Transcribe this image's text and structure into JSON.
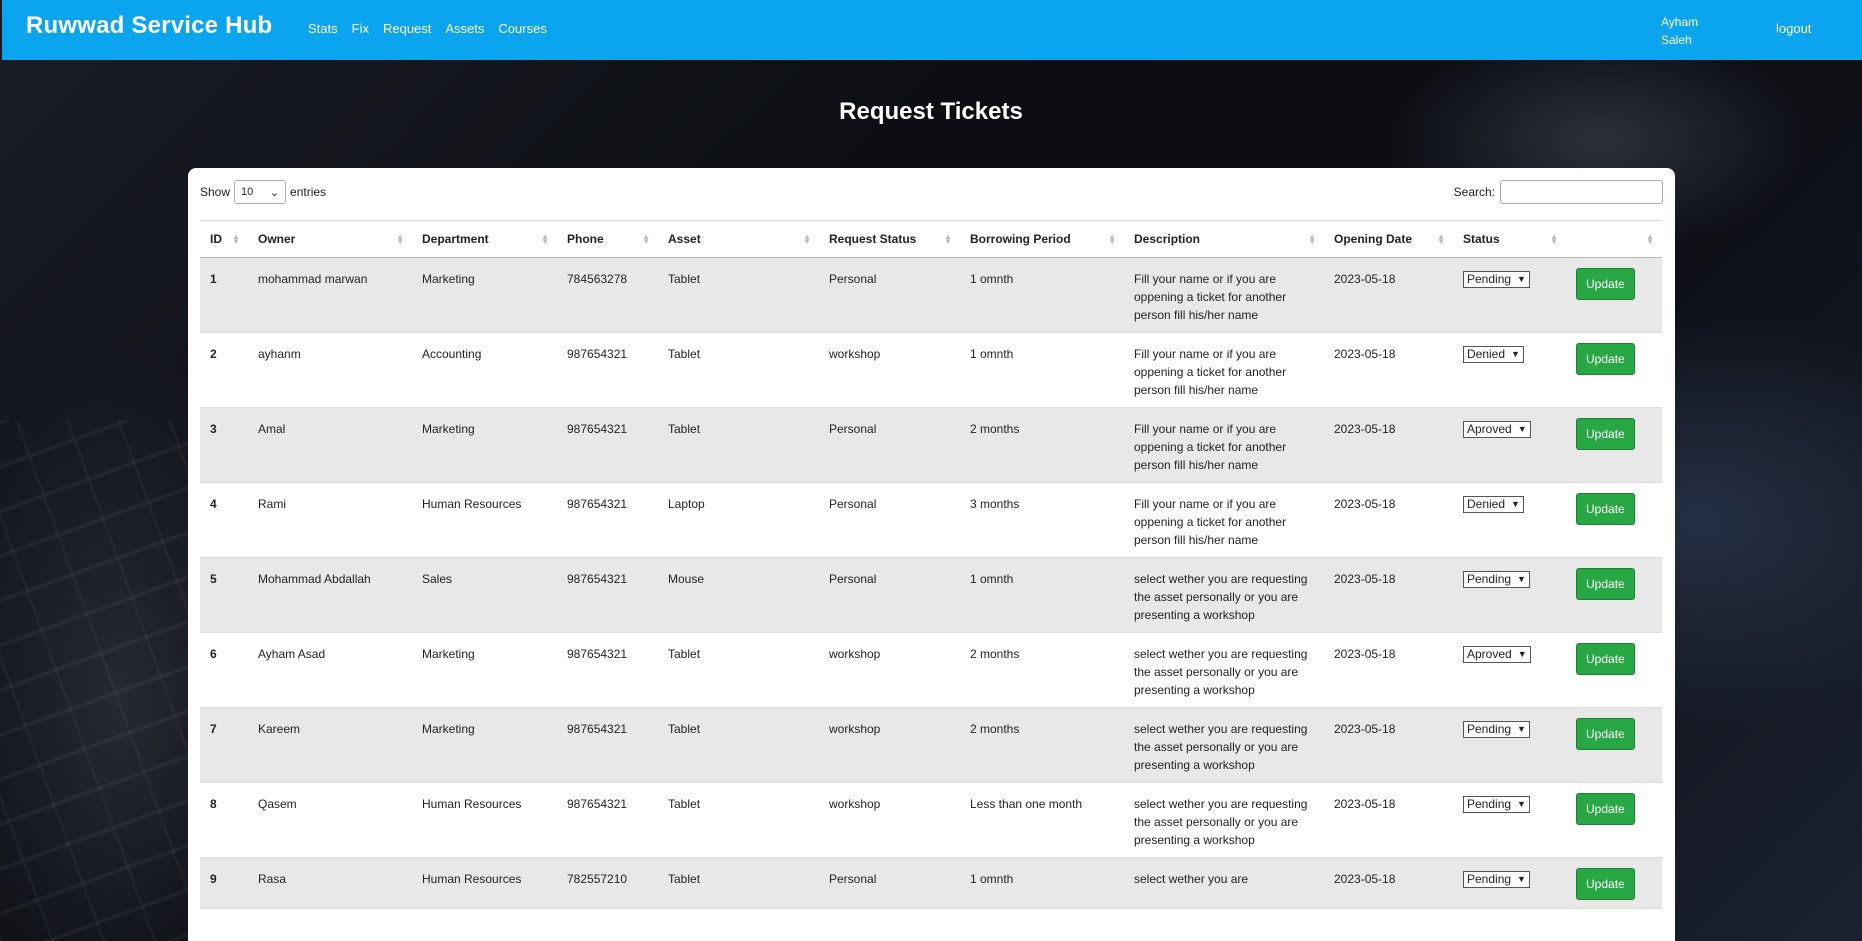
{
  "navbar": {
    "brand": "Ruwwad Service Hub",
    "links": [
      "Stats",
      "Fix",
      "Request",
      "Assets",
      "Courses"
    ],
    "user_first": "Ayham",
    "user_last": "Saleh",
    "logout": "logout"
  },
  "page": {
    "title": "Request Tickets"
  },
  "table_controls": {
    "show_label": "Show",
    "length_value": "10",
    "entries_label": "entries",
    "search_label": "Search:"
  },
  "columns": [
    "ID",
    "Owner",
    "Department",
    "Phone",
    "Asset",
    "Request Status",
    "Borrowing Period",
    "Description",
    "Opening Date",
    "Status",
    ""
  ],
  "rows": [
    {
      "id": "1",
      "owner": "mohammad marwan",
      "department": "Marketing",
      "phone": "784563278",
      "asset": "Tablet",
      "request_status": "Personal",
      "period": "1 omnth",
      "description": "Fill your name or if you are oppening a ticket for another person fill his/her name",
      "date": "2023-05-18",
      "status": "Pending",
      "action": "Update"
    },
    {
      "id": "2",
      "owner": "ayhanm",
      "department": "Accounting",
      "phone": "987654321",
      "asset": "Tablet",
      "request_status": "workshop",
      "period": "1 omnth",
      "description": "Fill your name or if you are oppening a ticket for another person fill his/her name",
      "date": "2023-05-18",
      "status": "Denied",
      "action": "Update"
    },
    {
      "id": "3",
      "owner": "Amal",
      "department": "Marketing",
      "phone": "987654321",
      "asset": "Tablet",
      "request_status": "Personal",
      "period": "2 months",
      "description": "Fill your name or if you are oppening a ticket for another person fill his/her name",
      "date": "2023-05-18",
      "status": "Aproved",
      "action": "Update"
    },
    {
      "id": "4",
      "owner": "Rami",
      "department": "Human Resources",
      "phone": "987654321",
      "asset": "Laptop",
      "request_status": "Personal",
      "period": "3 months",
      "description": "Fill your name or if you are oppening a ticket for another person fill his/her name",
      "date": "2023-05-18",
      "status": "Denied",
      "action": "Update"
    },
    {
      "id": "5",
      "owner": "Mohammad Abdallah",
      "department": "Sales",
      "phone": "987654321",
      "asset": "Mouse",
      "request_status": "Personal",
      "period": "1 omnth",
      "description": "select wether you are requesting the asset personally or you are presenting a workshop",
      "date": "2023-05-18",
      "status": "Pending",
      "action": "Update"
    },
    {
      "id": "6",
      "owner": "Ayham Asad",
      "department": "Marketing",
      "phone": "987654321",
      "asset": "Tablet",
      "request_status": "workshop",
      "period": "2 months",
      "description": "select wether you are requesting the asset personally or you are presenting a workshop",
      "date": "2023-05-18",
      "status": "Aproved",
      "action": "Update"
    },
    {
      "id": "7",
      "owner": "Kareem",
      "department": "Marketing",
      "phone": "987654321",
      "asset": "Tablet",
      "request_status": "workshop",
      "period": "2 months",
      "description": "select wether you are requesting the asset personally or you are presenting a workshop",
      "date": "2023-05-18",
      "status": "Pending",
      "action": "Update"
    },
    {
      "id": "8",
      "owner": "Qasem",
      "department": "Human Resources",
      "phone": "987654321",
      "asset": "Tablet",
      "request_status": "workshop",
      "period": "Less than one month",
      "description": "select wether you are requesting the asset personally or you are presenting a workshop",
      "date": "2023-05-18",
      "status": "Pending",
      "action": "Update"
    },
    {
      "id": "9",
      "owner": "Rasa",
      "department": "Human Resources",
      "phone": "782557210",
      "asset": "Tablet",
      "request_status": "Personal",
      "period": "1 omnth",
      "description": "select wether you are",
      "date": "2023-05-18",
      "status": "Pending",
      "action": "Update"
    }
  ],
  "colors": {
    "navbar": "#0aa5ee",
    "update_button": "#28a745",
    "stripe": "#e8e8e8"
  }
}
